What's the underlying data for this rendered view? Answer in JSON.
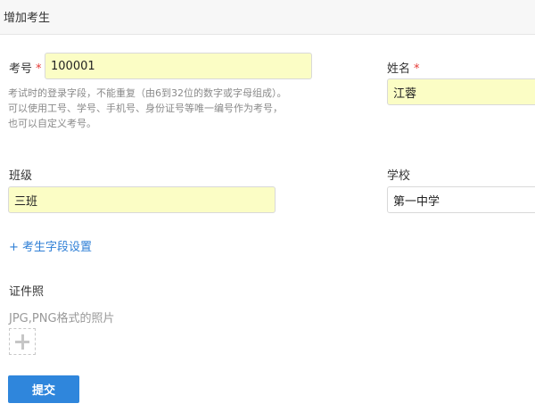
{
  "header": {
    "title": "增加考生"
  },
  "form": {
    "exam_no": {
      "label": "考号",
      "required_mark": "*",
      "value": "100001",
      "help": [
        "考试时的登录字段，不能重复（由6到32位的数字或字母组成）。",
        "可以使用工号、学号、手机号、身份证号等唯一编号作为考号，",
        "也可以自定义考号。"
      ]
    },
    "name": {
      "label": "姓名",
      "required_mark": "*",
      "value": "江蓉"
    },
    "class": {
      "label": "班级",
      "value": "三班"
    },
    "school": {
      "label": "学校",
      "value": "第一中学"
    },
    "field_settings_link": "+ 考生字段设置",
    "photo": {
      "label": "证件照",
      "hint": "JPG,PNG格式的照片"
    },
    "submit_label": "提交"
  },
  "icons": {
    "upload": "plus-icon"
  }
}
